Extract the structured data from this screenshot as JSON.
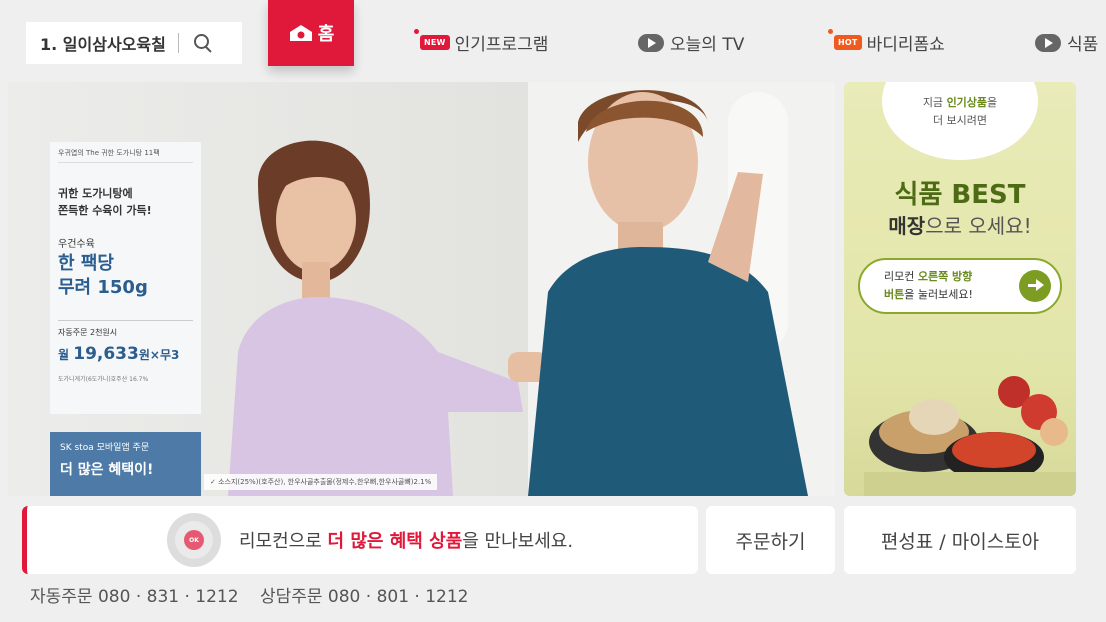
{
  "search": {
    "query": "1. 일이삼사오육칠"
  },
  "nav": {
    "home": "홈",
    "items": [
      {
        "badge": "NEW",
        "label": "인기프로그램"
      },
      {
        "label": "오늘의 TV"
      },
      {
        "badge": "HOT",
        "label": "바디리폼쇼"
      },
      {
        "label": "식품"
      }
    ]
  },
  "hero": {
    "card_top": "우귀엽의 The 귀한 도가니탕 11팩",
    "headline_1": "귀한 도가니탕에",
    "headline_2": "쫀득한 수육이 가득!",
    "label_1": "우건수육",
    "big_1": "한 팩당",
    "big_2": "무려 150g",
    "auto_order": "자동주문 2천원시",
    "price_prefix": "월",
    "price": "19,633",
    "price_suffix": "원×무3",
    "card_bottom": "도가니게기(6도가니)호주산 16.7%",
    "promo_1": "SK stoa 모바일앱 주문",
    "promo_2": "더 많은 혜택이!",
    "footnote": "✓ 소스지(25%)(호주산), 한우사골추출물(정제수,한우뼈,한우사골뼈)2.1%"
  },
  "side_ad": {
    "bubble_1a": "지금 ",
    "bubble_1b": "인기상품",
    "bubble_1c": "을",
    "bubble_2": "더 보시려면",
    "title": "식품 BEST",
    "sub_b": "매장",
    "sub_rest": "으로 오세요!",
    "pill_1a": "리모컨 ",
    "pill_1b": "오른쪽 방향",
    "pill_2a": "버튼",
    "pill_2b": "을 눌러보세요!"
  },
  "remote": {
    "ok": "OK",
    "text_1": "리모컨으로 ",
    "text_red": "더 많은 혜택 상품",
    "text_2": "을 만나보세요."
  },
  "buttons": {
    "order": "주문하기",
    "schedule": "편성표 / 마이스토아"
  },
  "phones": {
    "auto": "자동주문 080 · 831 · 1212",
    "consult": "상담주문 080 · 801 · 1212"
  },
  "colors": {
    "accent": "#e0183a",
    "food_green": "#6a8a1d",
    "blue": "#2b5e8e"
  }
}
